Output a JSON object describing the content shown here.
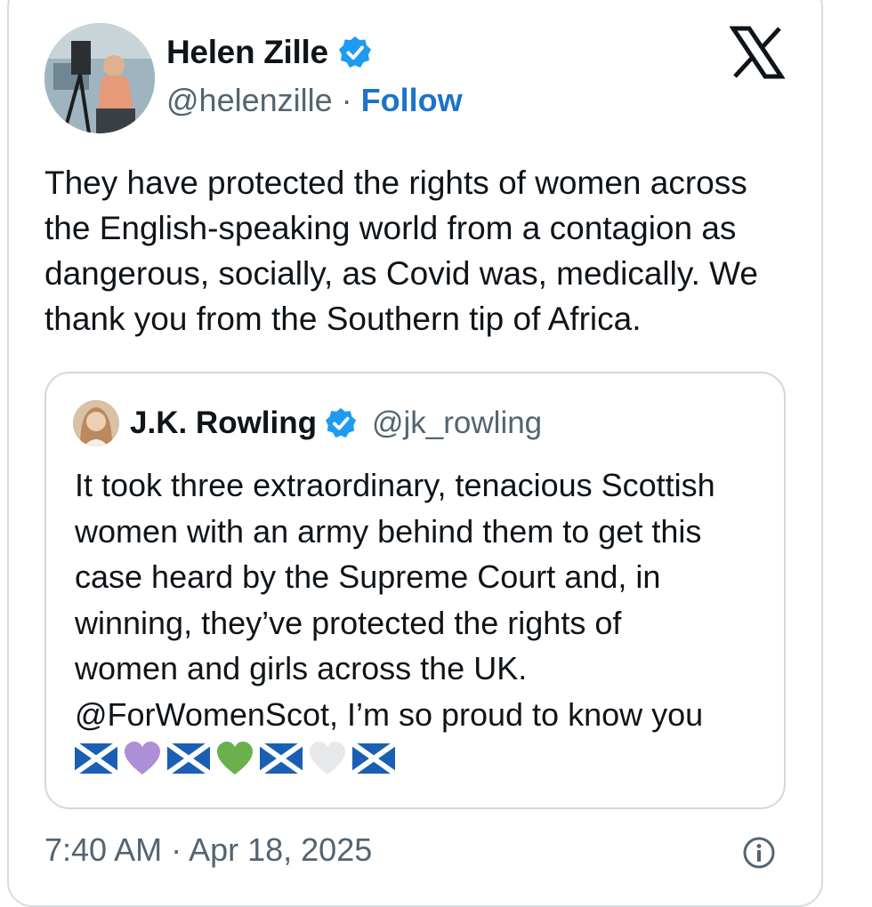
{
  "author": {
    "name": "Helen Zille",
    "handle": "@helenzille",
    "separator": "·",
    "follow_label": "Follow",
    "verified": true,
    "verified_color": "#1d9bf0"
  },
  "tweet": {
    "text": "They have protected the rights of women across\nthe English-speaking world from a contagion as\ndangerous, socially, as Covid was, medically. We\nthank you from the Southern tip of Africa.",
    "timestamp": "7:40 AM · Apr 18, 2025"
  },
  "quoted": {
    "name": "J.K. Rowling",
    "handle": "@jk_rowling",
    "verified": true,
    "text": "It took three extraordinary, tenacious Scottish\nwomen with an army behind them to get this\ncase heard by the Supreme Court and, in\nwinning, they’ve protected the rights of\nwomen and girls across the UK.\n@ForWomenScot, I’m so proud to know you",
    "emojis": [
      "scotland-flag",
      "purple-heart",
      "scotland-flag",
      "green-heart",
      "scotland-flag",
      "white-heart",
      "scotland-flag"
    ]
  },
  "icons": {
    "platform_logo": "x-logo-icon",
    "info": "info-icon"
  },
  "colors": {
    "link_blue": "#1d73c9",
    "muted": "#536471",
    "border": "#cfd9de"
  }
}
